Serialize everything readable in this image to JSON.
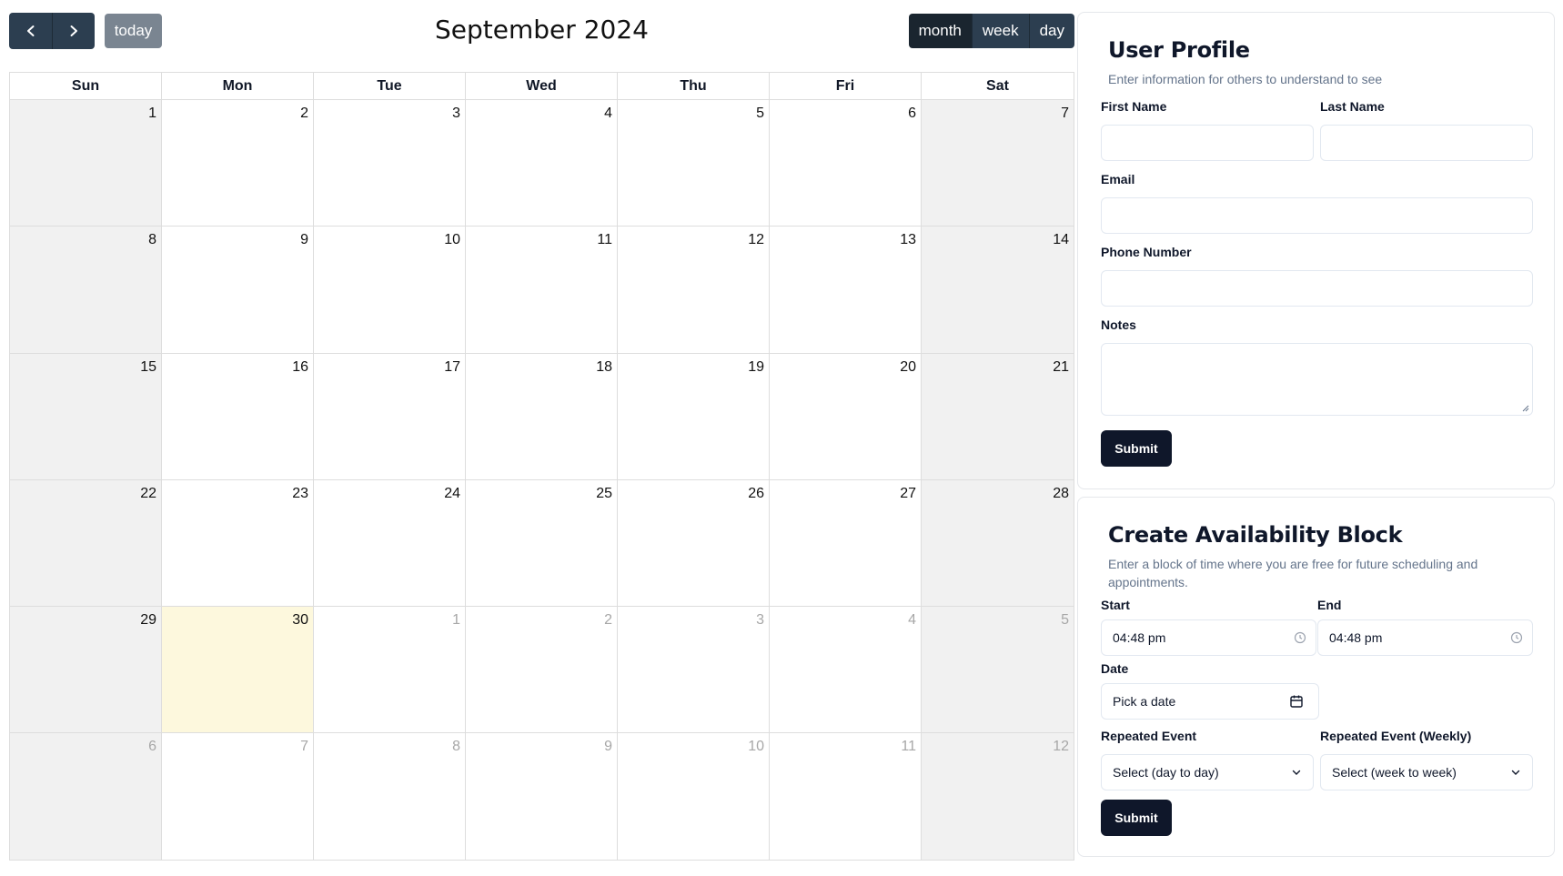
{
  "calendar": {
    "title": "September 2024",
    "today_label": "today",
    "views": [
      "month",
      "week",
      "day"
    ],
    "active_view": "month",
    "weekdays": [
      "Sun",
      "Mon",
      "Tue",
      "Wed",
      "Thu",
      "Fri",
      "Sat"
    ],
    "weeks": [
      [
        "1",
        "2",
        "3",
        "4",
        "5",
        "6",
        "7"
      ],
      [
        "8",
        "9",
        "10",
        "11",
        "12",
        "13",
        "14"
      ],
      [
        "15",
        "16",
        "17",
        "18",
        "19",
        "20",
        "21"
      ],
      [
        "22",
        "23",
        "24",
        "25",
        "26",
        "27",
        "28"
      ],
      [
        "29",
        "30",
        "1",
        "2",
        "3",
        "4",
        "5"
      ],
      [
        "6",
        "7",
        "8",
        "9",
        "10",
        "11",
        "12"
      ]
    ],
    "today_day": "30"
  },
  "profile": {
    "title": "User Profile",
    "description": "Enter information for others to understand to see",
    "first_name_label": "First Name",
    "last_name_label": "Last Name",
    "email_label": "Email",
    "phone_label": "Phone Number",
    "notes_label": "Notes",
    "submit_label": "Submit"
  },
  "availability": {
    "title": "Create Availability Block",
    "description": "Enter a block of time where you are free for future scheduling and appointments.",
    "start_label": "Start",
    "end_label": "End",
    "start_value": "04:48 pm",
    "end_value": "04:48 pm",
    "date_label": "Date",
    "date_placeholder": "Pick a date",
    "repeat_label": "Repeated Event",
    "repeat_weekly_label": "Repeated Event (Weekly)",
    "repeat_value": "Select (day to day)",
    "repeat_weekly_value": "Select (week to week)",
    "submit_label": "Submit"
  }
}
